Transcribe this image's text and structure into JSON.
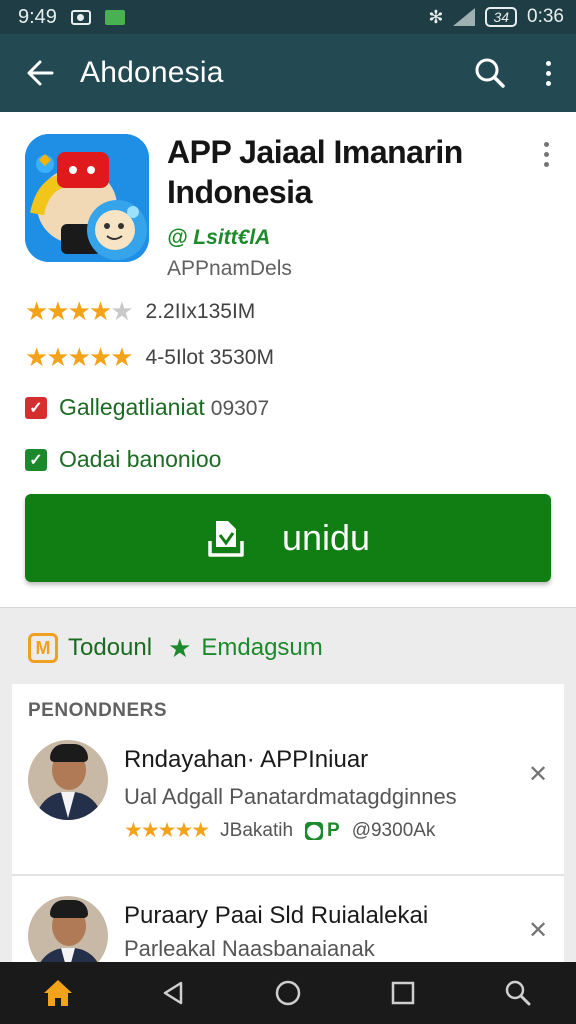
{
  "status_bar": {
    "time_left": "9:49",
    "battery": "34",
    "time_right": "0:36"
  },
  "app_bar": {
    "title": "Ahdonesia"
  },
  "app": {
    "title": "APP Jaiaal Imanarin Indonesia",
    "developer": "@ Lsitt€lA",
    "category": "APPnamDels",
    "ratings": [
      {
        "stars": 4.5,
        "text": "2.2IIx135IM"
      },
      {
        "stars": 5,
        "text": "4-5Ilot 3530M"
      }
    ],
    "checks": [
      {
        "label": "Gallegatlianiat",
        "extra": "09307",
        "color": "#d32f2f"
      },
      {
        "label": "Oadai banonioo",
        "extra": "",
        "color": "#1c8a2c"
      }
    ],
    "install_label": "unidu"
  },
  "tabs": [
    {
      "label": "Todounl"
    },
    {
      "label": "Emdagsum"
    }
  ],
  "list": {
    "header": "PENONDNERS",
    "items": [
      {
        "title": "Rndayahan· APPIniuar",
        "subtitle": "Ual Adgall Panatardmatagdginnes",
        "rating_text": "JBakatih",
        "badge": "P",
        "count": "@9300Ak"
      },
      {
        "title": "Puraary Paai Sld Ruialalekai",
        "subtitle": "Parleakal Naasbanaianak"
      }
    ]
  },
  "colors": {
    "primary": "#234a52",
    "install": "#117e14",
    "star": "#f2a31a",
    "accent_green": "#1c8a2c"
  }
}
